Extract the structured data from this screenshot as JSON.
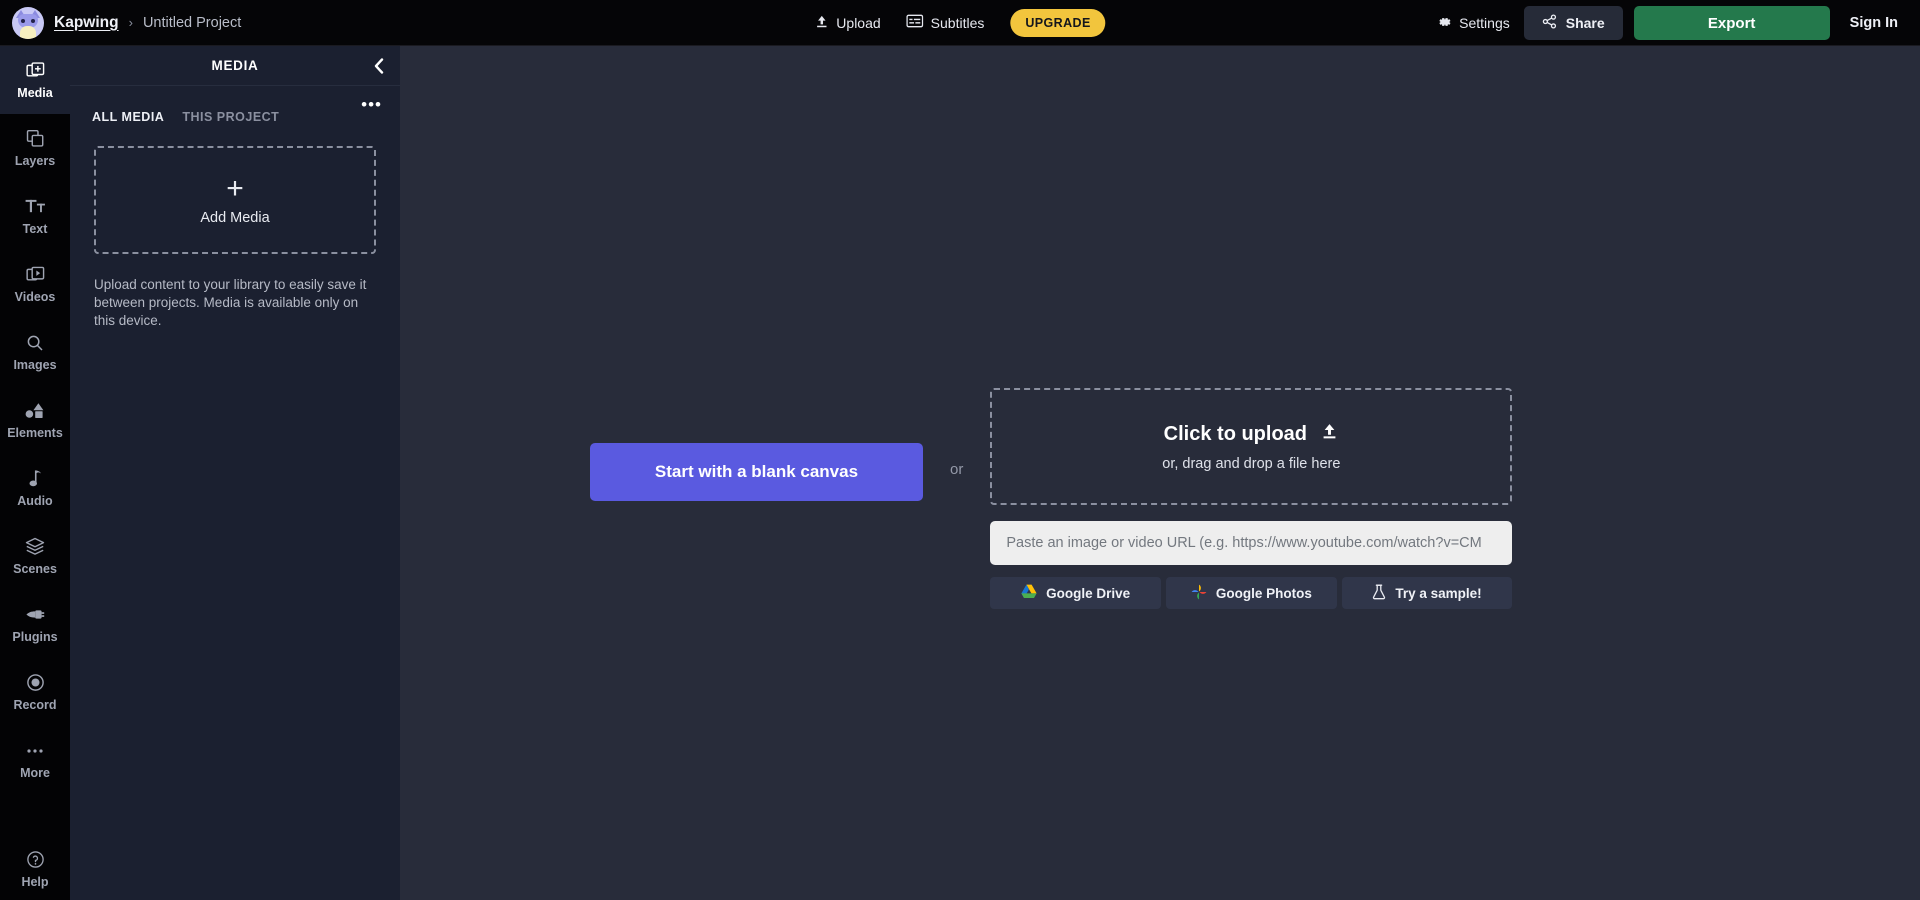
{
  "topbar": {
    "brand": "Kapwing",
    "breadcrumb_separator": "›",
    "project_name": "Untitled Project",
    "upload_label": "Upload",
    "subtitles_label": "Subtitles",
    "upgrade_label": "UPGRADE",
    "settings_label": "Settings",
    "share_label": "Share",
    "export_label": "Export",
    "signin_label": "Sign In",
    "icons": {
      "logo": "kapwing-cat-logo",
      "upload": "upload-icon",
      "subtitles": "subtitles-icon",
      "settings": "gear-icon",
      "share": "share-icon"
    }
  },
  "rail": {
    "items": [
      {
        "label": "Media",
        "icon": "media-add-icon",
        "active": true
      },
      {
        "label": "Layers",
        "icon": "layers-icon",
        "active": false
      },
      {
        "label": "Text",
        "icon": "text-icon",
        "active": false
      },
      {
        "label": "Videos",
        "icon": "video-icon",
        "active": false
      },
      {
        "label": "Images",
        "icon": "search-icon",
        "active": false
      },
      {
        "label": "Elements",
        "icon": "shapes-icon",
        "active": false
      },
      {
        "label": "Audio",
        "icon": "music-note-icon",
        "active": false
      },
      {
        "label": "Scenes",
        "icon": "stack-icon",
        "active": false
      },
      {
        "label": "Plugins",
        "icon": "plug-icon",
        "active": false
      },
      {
        "label": "Record",
        "icon": "record-icon",
        "active": false
      },
      {
        "label": "More",
        "icon": "ellipsis-icon",
        "active": false
      }
    ],
    "help": {
      "label": "Help",
      "icon": "question-circle-icon"
    }
  },
  "panel": {
    "title": "MEDIA",
    "collapse_icon": "chevron-left-icon",
    "more_icon": "ellipsis-icon",
    "more_glyph": "•••",
    "tabs": [
      {
        "label": "ALL MEDIA",
        "active": true
      },
      {
        "label": "THIS PROJECT",
        "active": false
      }
    ],
    "dropzone": {
      "plus_glyph": "+",
      "label": "Add Media"
    },
    "note": "Upload content to your library to easily save it between projects. Media is available only on this device."
  },
  "main": {
    "blank_canvas_label": "Start with a blank canvas",
    "or_label": "or",
    "upload": {
      "title": "Click to upload",
      "title_icon": "upload-icon",
      "subtitle": "or, drag and drop a file here"
    },
    "url_field": {
      "value": "",
      "placeholder": "Paste an image or video URL (e.g. https://www.youtube.com/watch?v=CM"
    },
    "services": [
      {
        "label": "Google Drive",
        "icon": "google-drive-icon"
      },
      {
        "label": "Google Photos",
        "icon": "google-photos-icon"
      },
      {
        "label": "Try a sample!",
        "icon": "flask-icon"
      }
    ]
  },
  "colors": {
    "topbar_bg": "#050507",
    "rail_bg": "#030305",
    "panel_bg": "#1b2030",
    "canvas_bg": "#282c3a",
    "accent_purple": "#5a5ae0",
    "export_green": "#24794c",
    "upgrade_gold": "#f2c53d",
    "share_bg": "#262b38",
    "service_bg": "#30364a",
    "input_bg": "#eeeeee"
  }
}
